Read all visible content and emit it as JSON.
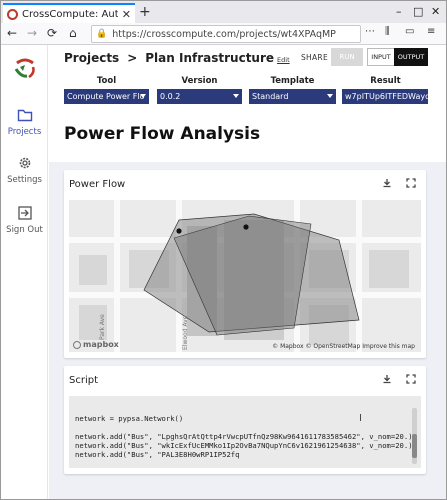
{
  "browser": {
    "tab_title": "CrossCompute: Automat",
    "tab_close": "✕",
    "new_tab": "+",
    "url": "https://crosscompute.com/projects/wt4XPAqMP",
    "window_controls": [
      "–",
      "□",
      "✕"
    ]
  },
  "sidebar": {
    "items": [
      {
        "label": "Projects",
        "icon": "folder-icon",
        "active": true
      },
      {
        "label": "Settings",
        "icon": "gear-icon",
        "active": false
      },
      {
        "label": "Sign Out",
        "icon": "sign-out-icon",
        "active": false
      }
    ]
  },
  "header": {
    "breadcrumb_root": "Projects",
    "breadcrumb_sep": ">",
    "breadcrumb_current": "Plan Infrastructure",
    "edit_link": "Edit",
    "share_label": "SHARE",
    "run_label": "RUN",
    "input_label": "INPUT",
    "output_label": "OUTPUT"
  },
  "filters": [
    {
      "label": "Tool",
      "value": "Compute Power Flo"
    },
    {
      "label": "Version",
      "value": "0.0.2"
    },
    {
      "label": "Template",
      "value": "Standard"
    },
    {
      "label": "Result",
      "value": "w7pITUp6ITFEDWayq"
    }
  ],
  "page_title": "Power Flow Analysis",
  "power_flow_card": {
    "title": "Power Flow",
    "map_credits": "© Mapbox  © OpenStreetMap  Improve this map",
    "mapbox_logo": "mapbox",
    "street_labels": [
      "Park Ave",
      "Elwood Ave"
    ]
  },
  "script_card": {
    "title": "Script",
    "lines": [
      "network = pypsa.Network()",
      "",
      "network.add(\"Bus\", \"LpghsQrAtQttp4rVwcpUTfnQz98Kw9641611783585462\", v_nom=20.)",
      "network.add(\"Bus\", \"wkIcExfUcEMMko1Ip2OvBa7NQupYnC6v1621961254638\", v_nom=20.)",
      "network.add(\"Bus\", \"PAL3E8H0wRP1IP52fq"
    ]
  },
  "colors": {
    "accent": "#3f51b5",
    "select_bg": "#2b3a7a",
    "tab_highlight": "#0a84ff"
  }
}
